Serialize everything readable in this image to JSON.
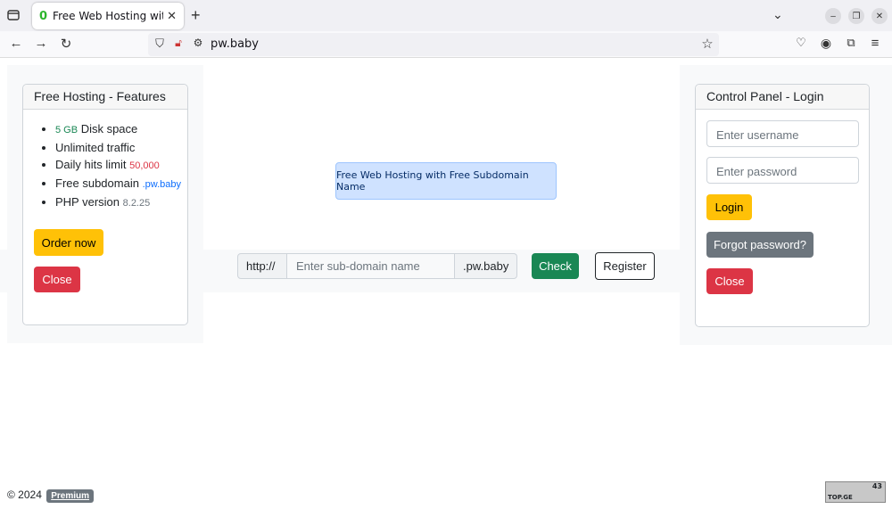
{
  "browser": {
    "tab_title": "Free Web Hosting with F",
    "tab_favicon": "0",
    "url": "pw.baby"
  },
  "features_card": {
    "header": "Free Hosting - Features",
    "items": [
      {
        "value": "5 GB",
        "label": " Disk space"
      },
      {
        "label": "Unlimited traffic"
      },
      {
        "label": "Daily hits limit ",
        "value": "50,000"
      },
      {
        "label": "Free subdomain ",
        "value": ".pw.baby"
      },
      {
        "label": "PHP version ",
        "value": "8.2.25"
      }
    ],
    "order_button": "Order now",
    "close_button": "Close"
  },
  "center": {
    "alert": "Free Web Hosting with Free Subdomain Name",
    "prefix": "http://",
    "subdomain_placeholder": "Enter sub-domain name",
    "suffix": ".pw.baby",
    "check_button": "Check",
    "register_button": "Register"
  },
  "login_card": {
    "header": "Control Panel - Login",
    "username_placeholder": "Enter username",
    "password_placeholder": "Enter password",
    "login_button": "Login",
    "forgot_button": "Forgot password?",
    "close_button": "Close"
  },
  "footer": {
    "copyright": "© 2024",
    "badge": "Premium"
  },
  "counter": {
    "label": "TOP.GE",
    "count": "43"
  },
  "colors": {
    "primary_warning": "#ffc107",
    "danger": "#dc3545",
    "success": "#198754",
    "secondary": "#6c757d",
    "alert_bg": "#cfe2ff"
  }
}
